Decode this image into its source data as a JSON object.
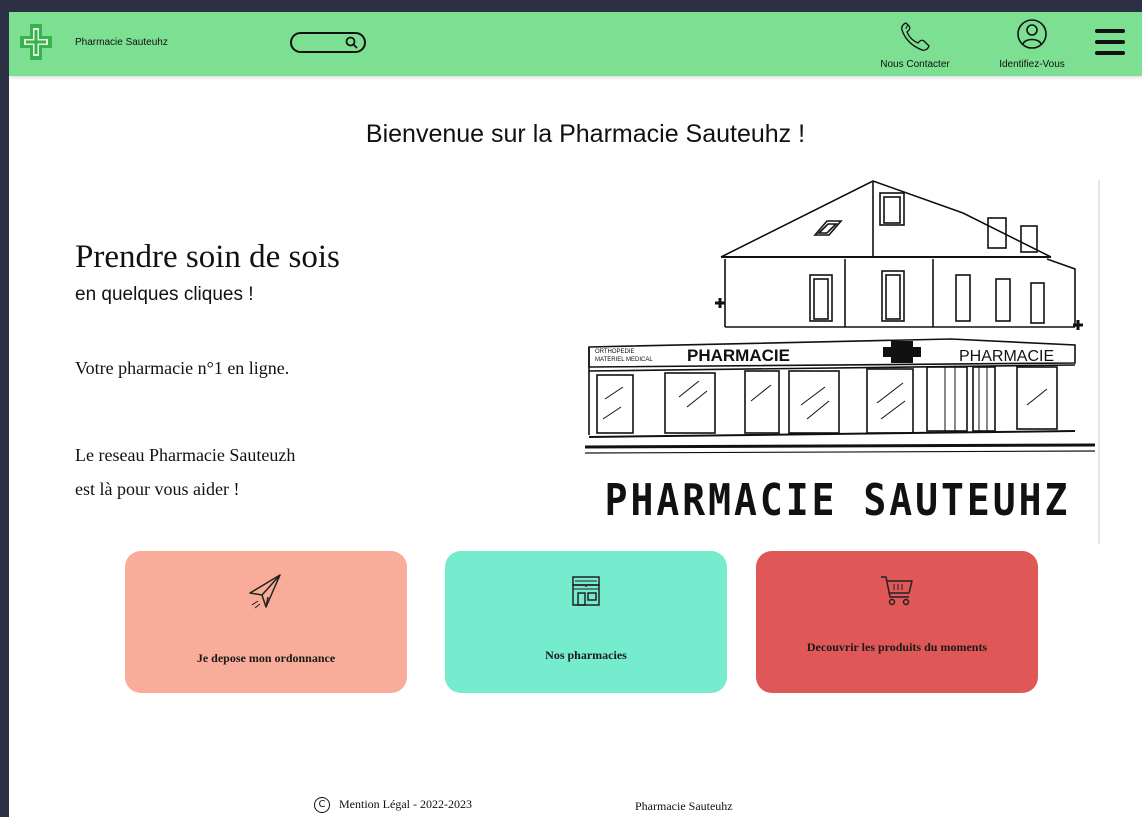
{
  "colors": {
    "header_bg": "#7ddf92",
    "logo_green": "#37b24d",
    "card_prescription": "#f8ac99",
    "card_pharmacies": "#76eccf",
    "card_products": "#e05757"
  },
  "header": {
    "brand": "Pharmacie Sauteuhz",
    "logo_icon": "green-cross-icon",
    "search_icon": "search-icon",
    "contact": {
      "label": "Nous Contacter",
      "icon": "phone-icon"
    },
    "login": {
      "label": "Identifiez-Vous",
      "icon": "user-circle-icon"
    },
    "menu_icon": "hamburger-menu-icon"
  },
  "hero": {
    "welcome": "Bienvenue sur la Pharmacie Sauteuhz !",
    "title": "Prendre soin de sois",
    "subtitle": "en quelques cliques !",
    "line1": "Votre pharmacie n°1 en ligne.",
    "line2a": "Le reseau Pharmacie Sauteuzh",
    "line2b": "est là pour vous aider !",
    "image": {
      "sign_left": "PHARMACIE",
      "sign_right": "PHARMACIE",
      "sign_small_1": "ORTHOPEDIE",
      "sign_small_2": "MATERIEL MEDICAL",
      "caption": "PHARMACIE SAUTEUHZ"
    }
  },
  "cards": [
    {
      "label": "Je depose mon ordonnance",
      "icon": "paper-plane-icon"
    },
    {
      "label": "Nos pharmacies",
      "icon": "storefront-icon"
    },
    {
      "label": "Decouvrir les produits du moments",
      "icon": "shopping-cart-icon"
    }
  ],
  "footer": {
    "copyright_symbol": "C",
    "legal": "Mention Légal - 2022-2023",
    "brand": "Pharmacie Sauteuhz"
  }
}
